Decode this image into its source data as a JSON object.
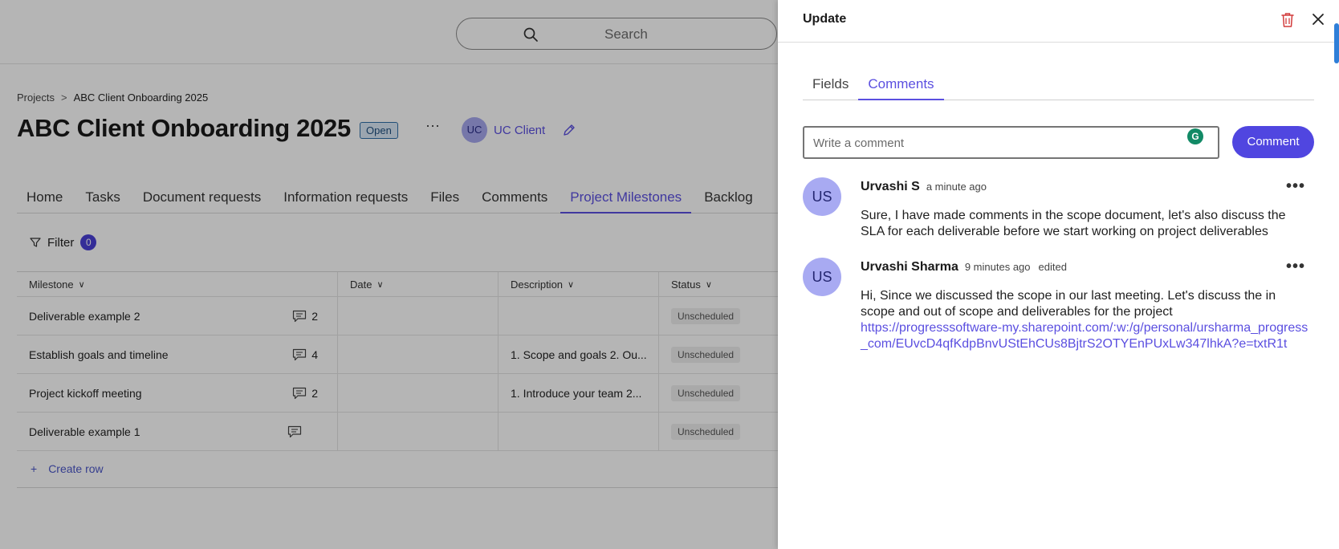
{
  "search": {
    "placeholder": "Search"
  },
  "breadcrumb": {
    "root": "Projects",
    "separator": ">",
    "current": "ABC Client Onboarding 2025"
  },
  "project": {
    "title": "ABC Client Onboarding 2025",
    "status": "Open",
    "more_label": "···",
    "client_initials": "UC",
    "client_name": "UC Client"
  },
  "tabs": [
    "Home",
    "Tasks",
    "Document requests",
    "Information requests",
    "Files",
    "Comments",
    "Project Milestones",
    "Backlog"
  ],
  "active_tab": "Project Milestones",
  "filter": {
    "label": "Filter",
    "count": "0"
  },
  "table": {
    "columns": [
      "Milestone",
      "Date",
      "Description",
      "Status"
    ],
    "rows": [
      {
        "milestone": "Deliverable example 2",
        "comments": "2",
        "date": "",
        "description": "",
        "status": "Unscheduled"
      },
      {
        "milestone": "Establish goals and timeline",
        "comments": "4",
        "date": "",
        "description": "1. Scope and goals 2. Ou...",
        "status": "Unscheduled"
      },
      {
        "milestone": "Project kickoff meeting",
        "comments": "2",
        "date": "",
        "description": "1. Introduce your team 2...",
        "status": "Unscheduled"
      },
      {
        "milestone": "Deliverable example 1",
        "comments": "",
        "date": "",
        "description": "",
        "status": "Unscheduled"
      }
    ],
    "create_row": "Create row",
    "create_icon": "+"
  },
  "panel": {
    "title": "Update",
    "tabs": [
      "Fields",
      "Comments"
    ],
    "active_tab": "Comments",
    "composer_placeholder": "Write a comment",
    "grammarly_glyph": "G",
    "comment_button": "Comment",
    "comments": [
      {
        "initials": "US",
        "author": "Urvashi S",
        "time": "a minute ago",
        "edited": "",
        "body": "Sure, I have made comments in the scope document, let's also discuss the SLA for each deliverable before we start working on project deliverables",
        "link": ""
      },
      {
        "initials": "US",
        "author": "Urvashi Sharma",
        "time": "9 minutes ago",
        "edited": "edited",
        "body": "Hi, Since we discussed the scope in our last meeting. Let's  discuss the in scope and out of scope and deliverables for the project",
        "link": "https://progresssoftware-my.sharepoint.com/:w:/g/personal/ursharma_progress_com/EUvcD4qfKdpBnvUStEhCUs8BjtrS2OTYEnPUxLw347lhkA?e=txtR1t"
      }
    ],
    "dots": "•••"
  },
  "colors": {
    "accent": "#5b4fe0",
    "button": "#5046e0",
    "overlay": "rgba(0,0,0,0.29)"
  }
}
